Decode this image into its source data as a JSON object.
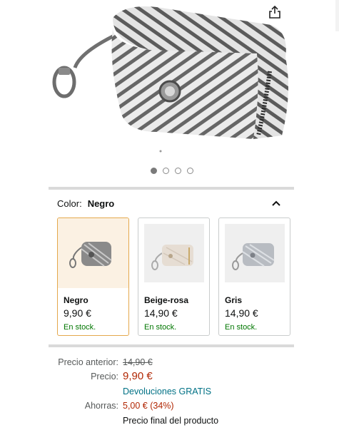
{
  "hero": {
    "image": "herringbone-fabric-dog-poop-bag-holder",
    "share_icon": "share-icon",
    "carousel_dots": [
      {
        "active": true
      },
      {
        "active": false
      },
      {
        "active": false
      },
      {
        "active": false
      }
    ]
  },
  "color_selector": {
    "label": "Color:",
    "selected": "Negro",
    "collapse_icon": "chevron-up-icon",
    "options": [
      {
        "name": "Negro",
        "price": "9,90 €",
        "stock": "En stock.",
        "selected": true,
        "swatch_color": "#7b7b7b"
      },
      {
        "name": "Beige-rosa",
        "price": "14,90 €",
        "stock": "En stock.",
        "selected": false,
        "swatch_color": "#e6ddd3"
      },
      {
        "name": "Gris",
        "price": "14,90 €",
        "stock": "En stock.",
        "selected": false,
        "swatch_color": "#b8bcc2"
      }
    ]
  },
  "pricing": {
    "previous_label": "Precio anterior:",
    "previous_value": "14,90 €",
    "price_label": "Precio:",
    "price_value": "9,90 €",
    "returns_link": "Devoluciones GRATIS",
    "savings_label": "Ahorras:",
    "savings_value": "5,00 € (34%)",
    "final_note": "Precio final del producto"
  },
  "colors": {
    "price_red": "#b12704",
    "stock_green": "#007600",
    "link_teal": "#007185",
    "selected_border": "#e4a84c"
  }
}
